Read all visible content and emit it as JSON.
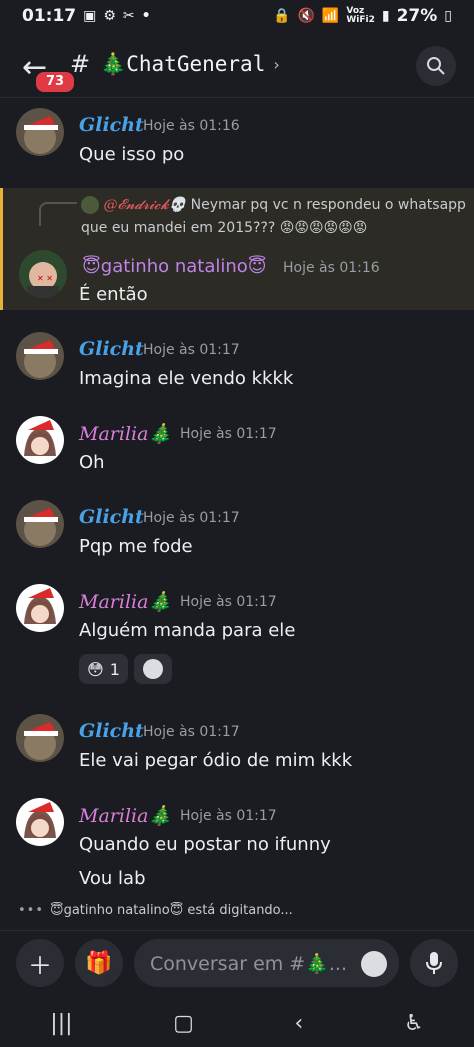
{
  "status_bar": {
    "time": "01:17",
    "left_icons": [
      "image-icon",
      "gear-icon",
      "capcut-icon",
      "dot"
    ],
    "volte": "Voz",
    "wifi_label": "WiFi2",
    "battery": "27%"
  },
  "header": {
    "badge_count": "73",
    "channel_name": "🎄ChatGeneral"
  },
  "messages": [
    {
      "id": "m1",
      "author": "Glicht",
      "time": "Hoje às 01:16",
      "lines": [
        "Que isso po"
      ]
    },
    {
      "id": "m2",
      "reply_to": {
        "author": "@𝓔𝓷𝓭𝓻𝓲𝓬𝓴💀",
        "text": "Neymar pq vc n respondeu o whatsapp que eu mandei em 2015???",
        "emoji": "😡😡😡😡😡😡"
      },
      "author": "😇gatinho natalino😇",
      "time": "Hoje às 01:16",
      "lines": [
        "É então"
      ]
    },
    {
      "id": "m3",
      "author": "Glicht",
      "time": "Hoje às 01:17",
      "lines": [
        "Imagina ele vendo kkkk"
      ]
    },
    {
      "id": "m4",
      "author": "Marilia🎄",
      "time": "Hoje às 01:17",
      "lines": [
        "Oh"
      ]
    },
    {
      "id": "m5",
      "author": "Glicht",
      "time": "Hoje às 01:17",
      "lines": [
        "Pqp me fode"
      ]
    },
    {
      "id": "m6",
      "author": "Marilia🎄",
      "time": "Hoje às 01:17",
      "lines": [
        "Alguém manda para ele"
      ],
      "reactions": [
        {
          "emoji": "😳",
          "count": "1"
        }
      ]
    },
    {
      "id": "m7",
      "author": "Glicht",
      "time": "Hoje às 01:17",
      "lines": [
        "Ele vai pegar ódio de mim kkk"
      ]
    },
    {
      "id": "m8",
      "author": "Marilia🎄",
      "time": "Hoje às 01:17",
      "lines": [
        "Quando eu postar no ifunny",
        "Vou lab"
      ]
    }
  ],
  "typing": "😇gatinho natalino😇 está digitando...",
  "composer": {
    "placeholder": "Conversar em #🎄..."
  },
  "colors": {
    "glicht": "#4aa2e6",
    "marilia": "#d97fd9",
    "gatinho": "#c083e8",
    "reply_accent": "#e7b23a",
    "badge": "#e03a45"
  }
}
